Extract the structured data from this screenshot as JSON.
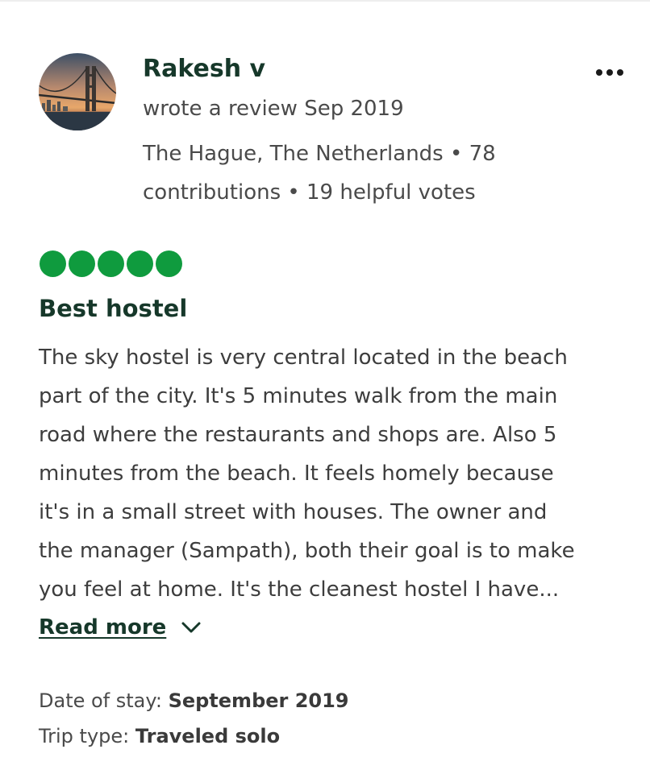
{
  "review": {
    "author": {
      "name": "Rakesh v",
      "activity": "wrote a review Sep 2019",
      "location_line": "The Hague, The Netherlands • 78",
      "stats_line": "contributions • 19 helpful votes",
      "avatar_icon": "bridge-photo-avatar"
    },
    "more_icon": "more-options-icon",
    "rating": {
      "value": 5,
      "max": 5,
      "color": "#0f9b3e"
    },
    "title": "Best hostel",
    "body_lines": [
      "The sky hostel is very central located in the beach",
      "part of the city. It's 5 minutes walk from the main",
      "road where the restaurants and shops are. Also 5",
      "minutes from the beach. It feels homely because",
      "it's in a small street with houses. The owner and",
      "the manager (Sampath), both their goal is to make",
      "you feel at home. It's the cleanest hostel I have..."
    ],
    "read_more": {
      "label": "Read more",
      "icon": "chevron-down-icon"
    },
    "details": {
      "date_of_stay_label": "Date of stay:",
      "date_of_stay_value": "September 2019",
      "trip_type_label": "Trip type:",
      "trip_type_value": "Traveled solo"
    }
  },
  "colors": {
    "heading": "#16382a",
    "text": "#3d3d3d",
    "rating_bubble": "#0f9b3e"
  }
}
